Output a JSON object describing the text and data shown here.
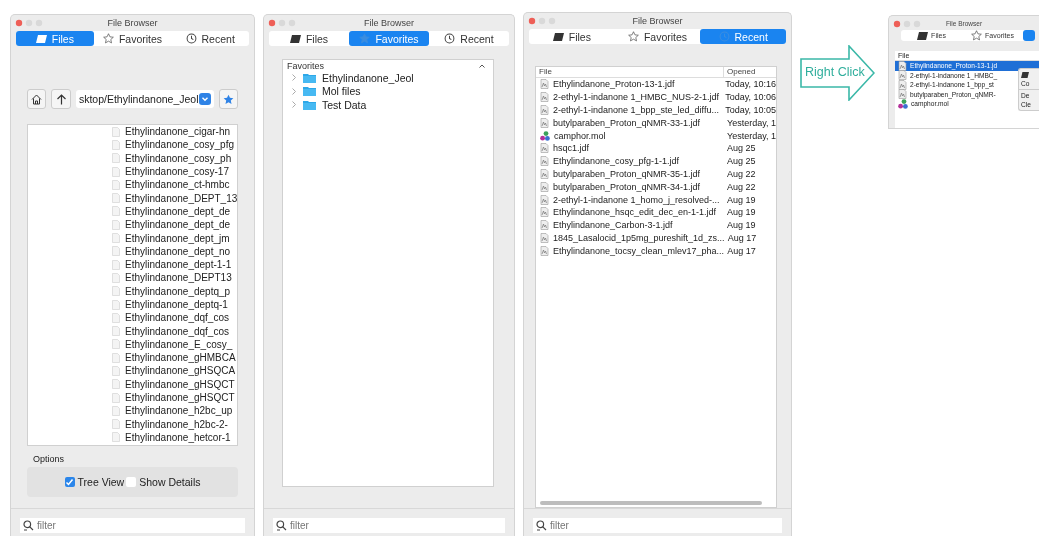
{
  "windows": [
    {
      "kind": "files",
      "title": "File Browser",
      "tabs": [
        {
          "label": "Files",
          "selected": true
        },
        {
          "label": "Favorites",
          "selected": false
        },
        {
          "label": "Recent",
          "selected": false
        }
      ],
      "path": "sktop/Ethylindanone_Jeol",
      "files": [
        "Ethylindanone_cigar-hn",
        "Ethylindanone_cosy_pfg",
        "Ethylindanone_cosy_ph",
        "Ethylindanone_cosy-17",
        "Ethylindanone_ct-hmbc",
        "Ethylindanone_DEPT_13",
        "Ethylindanone_dept_de",
        "Ethylindanone_dept_de",
        "Ethylindanone_dept_jm",
        "Ethylindanone_dept_no",
        "Ethylindanone_dept-1-1",
        "Ethylindanone_DEPT13",
        "Ethylindanone_deptq_p",
        "Ethylindanone_deptq-1",
        "Ethylindanone_dqf_cos",
        "Ethylindanone_dqf_cos",
        "Ethylindanone_E_cosy_",
        "Ethylindanone_gHMBCA",
        "Ethylindanone_gHSQCA",
        "Ethylindanone_gHSQCT",
        "Ethylindanone_gHSQCT",
        "Ethylindanone_h2bc_up",
        "Ethylindanone_h2bc-2-",
        "Ethylindanone_hetcor-1"
      ],
      "options": {
        "title": "Options",
        "checkboxes": [
          {
            "label": "Tree View",
            "checked": true
          },
          {
            "label": "Show Details",
            "checked": false
          }
        ]
      },
      "filter": {
        "placeholder": "filter"
      }
    },
    {
      "kind": "favorites",
      "title": "File Browser",
      "tabs": [
        {
          "label": "Files",
          "selected": false
        },
        {
          "label": "Favorites",
          "selected": true
        },
        {
          "label": "Recent",
          "selected": false
        }
      ],
      "tree": {
        "header": "Favorites",
        "items": [
          {
            "label": "Ethylindanone_Jeol",
            "expanded": false
          },
          {
            "label": "Mol files",
            "expanded": false
          },
          {
            "label": "Test Data",
            "expanded": false
          }
        ]
      },
      "filter": {
        "placeholder": "filter"
      }
    },
    {
      "kind": "recent",
      "title": "File Browser",
      "tabs": [
        {
          "label": "Files",
          "selected": false
        },
        {
          "label": "Favorites",
          "selected": false
        },
        {
          "label": "Recent",
          "selected": true
        }
      ],
      "table": {
        "columns": [
          "File",
          "Opened"
        ],
        "rows": [
          {
            "file": "Ethylindanone_Proton-13-1.jdf",
            "opened": "Today, 10:16",
            "kind": "spectrum"
          },
          {
            "file": "2-ethyl-1-indanone 1_HMBC_NUS-2-1.jdf",
            "opened": "Today, 10:06",
            "kind": "spectrum"
          },
          {
            "file": "2-ethyl-1-indanone 1_bpp_ste_led_diffu...",
            "opened": "Today, 10:05",
            "kind": "spectrum"
          },
          {
            "file": "butylparaben_Proton_qNMR-33-1.jdf",
            "opened": "Yesterday, 1",
            "kind": "spectrum"
          },
          {
            "file": "camphor.mol",
            "opened": "Yesterday, 1",
            "kind": "molecule"
          },
          {
            "file": "hsqc1.jdf",
            "opened": "Aug 25",
            "kind": "spectrum"
          },
          {
            "file": "Ethylindanone_cosy_pfg-1-1.jdf",
            "opened": "Aug 25",
            "kind": "spectrum"
          },
          {
            "file": "butylparaben_Proton_qNMR-35-1.jdf",
            "opened": "Aug 22",
            "kind": "spectrum"
          },
          {
            "file": "butylparaben_Proton_qNMR-34-1.jdf",
            "opened": "Aug 22",
            "kind": "spectrum"
          },
          {
            "file": "2-ethyl-1-indanone 1_homo_j_resolved-...",
            "opened": "Aug 19",
            "kind": "spectrum"
          },
          {
            "file": "Ethylindanone_hsqc_edit_dec_en-1-1.jdf",
            "opened": "Aug 19",
            "kind": "spectrum"
          },
          {
            "file": "Ethylindanone_Carbon-3-1.jdf",
            "opened": "Aug 19",
            "kind": "spectrum"
          },
          {
            "file": "1845_Lasalocid_1p5mg_pureshift_1d_zs...",
            "opened": "Aug 17",
            "kind": "spectrum"
          },
          {
            "file": "Ethylindanone_tocsy_clean_mlev17_pha...",
            "opened": "Aug 17",
            "kind": "spectrum"
          }
        ]
      },
      "filter": {
        "placeholder": "filter"
      }
    }
  ],
  "annotation": {
    "label": "Right Click"
  },
  "preview": {
    "title": "File Browser",
    "tabs": [
      {
        "label": "Files",
        "selected": false
      },
      {
        "label": "Favorites",
        "selected": false
      },
      {
        "selected": true
      }
    ],
    "table": {
      "columns": [
        "File"
      ],
      "rows": [
        {
          "file": "Ethylindanone_Proton-13-1.jd",
          "kind": "spectrum",
          "selected": true
        },
        {
          "file": "2-ethyl-1-indanone 1_HMBC_",
          "kind": "spectrum",
          "selected": false
        },
        {
          "file": "2-ethyl-1-indanone 1_bpp_st",
          "kind": "spectrum",
          "selected": false
        },
        {
          "file": "butylparaben_Proton_qNMR-",
          "kind": "spectrum",
          "selected": false
        },
        {
          "file": "camphor.mol",
          "kind": "molecule",
          "selected": false
        }
      ]
    },
    "context_menu": {
      "items": [
        {
          "kind": "icon"
        },
        {
          "kind": "text",
          "label": "Co"
        },
        {
          "kind": "separator"
        },
        {
          "kind": "text",
          "label": "De"
        },
        {
          "kind": "text",
          "label": "Cle"
        }
      ]
    }
  }
}
